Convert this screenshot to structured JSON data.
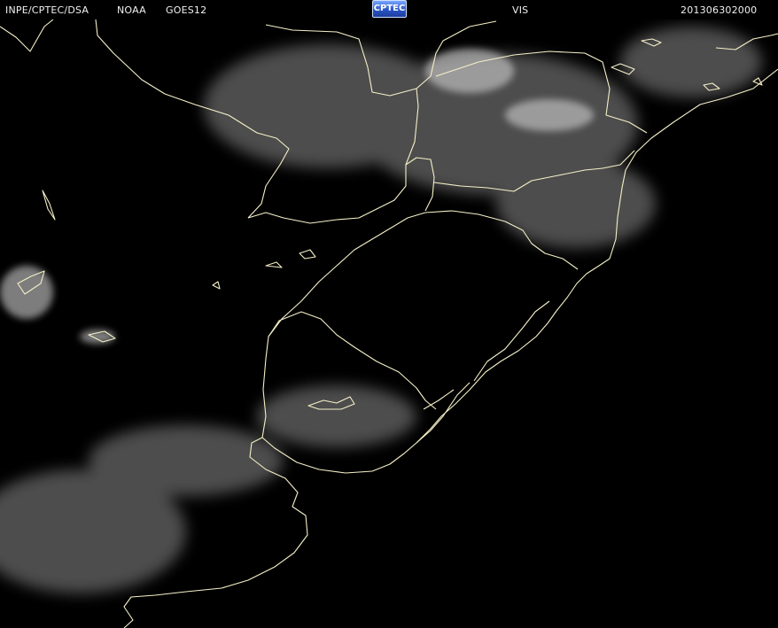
{
  "header": {
    "agency": "INPE/CPTEC/DSA",
    "source": "NOAA",
    "satellite": "GOES12",
    "logo_text": "CPTEC",
    "channel": "VIS",
    "timestamp": "201306302000"
  },
  "colors": {
    "background": "#000000",
    "boundaries": "#f5f0c8",
    "cloud": "#9a9a9a",
    "text": "#f0f0f0"
  }
}
